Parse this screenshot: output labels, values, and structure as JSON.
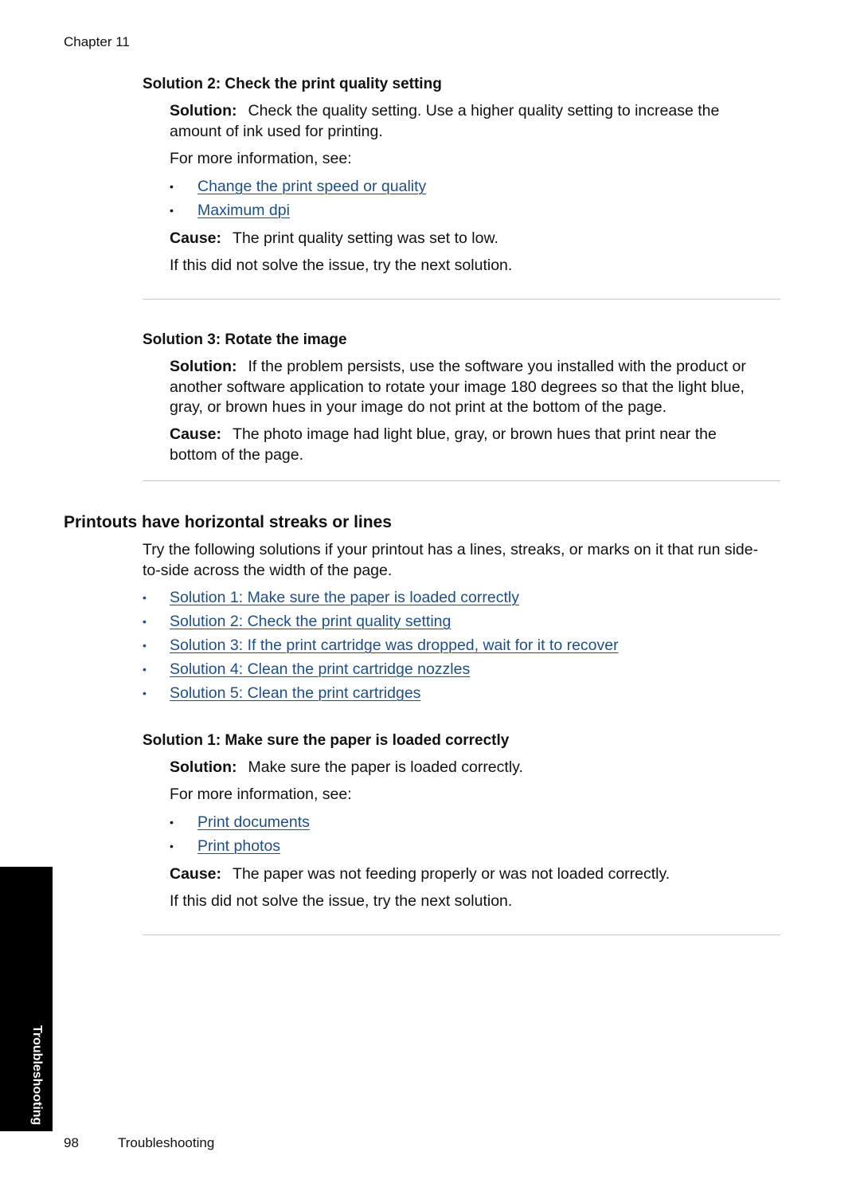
{
  "header": {
    "chapter": "Chapter 11"
  },
  "section_sol2": {
    "title": "Solution 2: Check the print quality setting",
    "solution_label": "Solution:",
    "solution_text_line1": "Check the quality setting. Use a higher quality setting to increase the",
    "solution_text_line2": "amount of ink used for printing.",
    "more_info": "For more information, see:",
    "links": [
      "Change the print speed or quality",
      "Maximum dpi"
    ],
    "cause_label": "Cause:",
    "cause_text": "The print quality setting was set to low.",
    "next": "If this did not solve the issue, try the next solution."
  },
  "section_sol3": {
    "title": "Solution 3: Rotate the image",
    "solution_label": "Solution:",
    "solution_text_line1": "If the problem persists, use the software you installed with the product or",
    "solution_text_line2": "another software application to rotate your image 180 degrees so that the light blue,",
    "solution_text_line3": "gray, or brown hues in your image do not print at the bottom of the page.",
    "cause_label": "Cause:",
    "cause_text_line1": "The photo image had light blue, gray, or brown hues that print near the",
    "cause_text_line2": "bottom of the page."
  },
  "streaks": {
    "title": "Printouts have horizontal streaks or lines",
    "intro_line1": "Try the following solutions if your printout has a lines, streaks, or marks on it that run side-",
    "intro_line2": "to-side across the width of the page.",
    "links": [
      "Solution 1: Make sure the paper is loaded correctly",
      "Solution 2: Check the print quality setting",
      "Solution 3: If the print cartridge was dropped, wait for it to recover",
      "Solution 4: Clean the print cartridge nozzles",
      "Solution 5: Clean the print cartridges"
    ]
  },
  "section_s1": {
    "title": "Solution 1: Make sure the paper is loaded correctly",
    "solution_label": "Solution:",
    "solution_text": "Make sure the paper is loaded correctly.",
    "more_info": "For more information, see:",
    "links": [
      "Print documents",
      "Print photos"
    ],
    "cause_label": "Cause:",
    "cause_text": "The paper was not feeding properly or was not loaded correctly.",
    "next": "If this did not solve the issue, try the next solution."
  },
  "side_tab": {
    "label": "Troubleshooting"
  },
  "footer": {
    "page_number": "98",
    "section": "Troubleshooting"
  },
  "colors": {
    "link": "#1d4f86",
    "tab": "#000000",
    "rule": "#c8c8c8"
  }
}
